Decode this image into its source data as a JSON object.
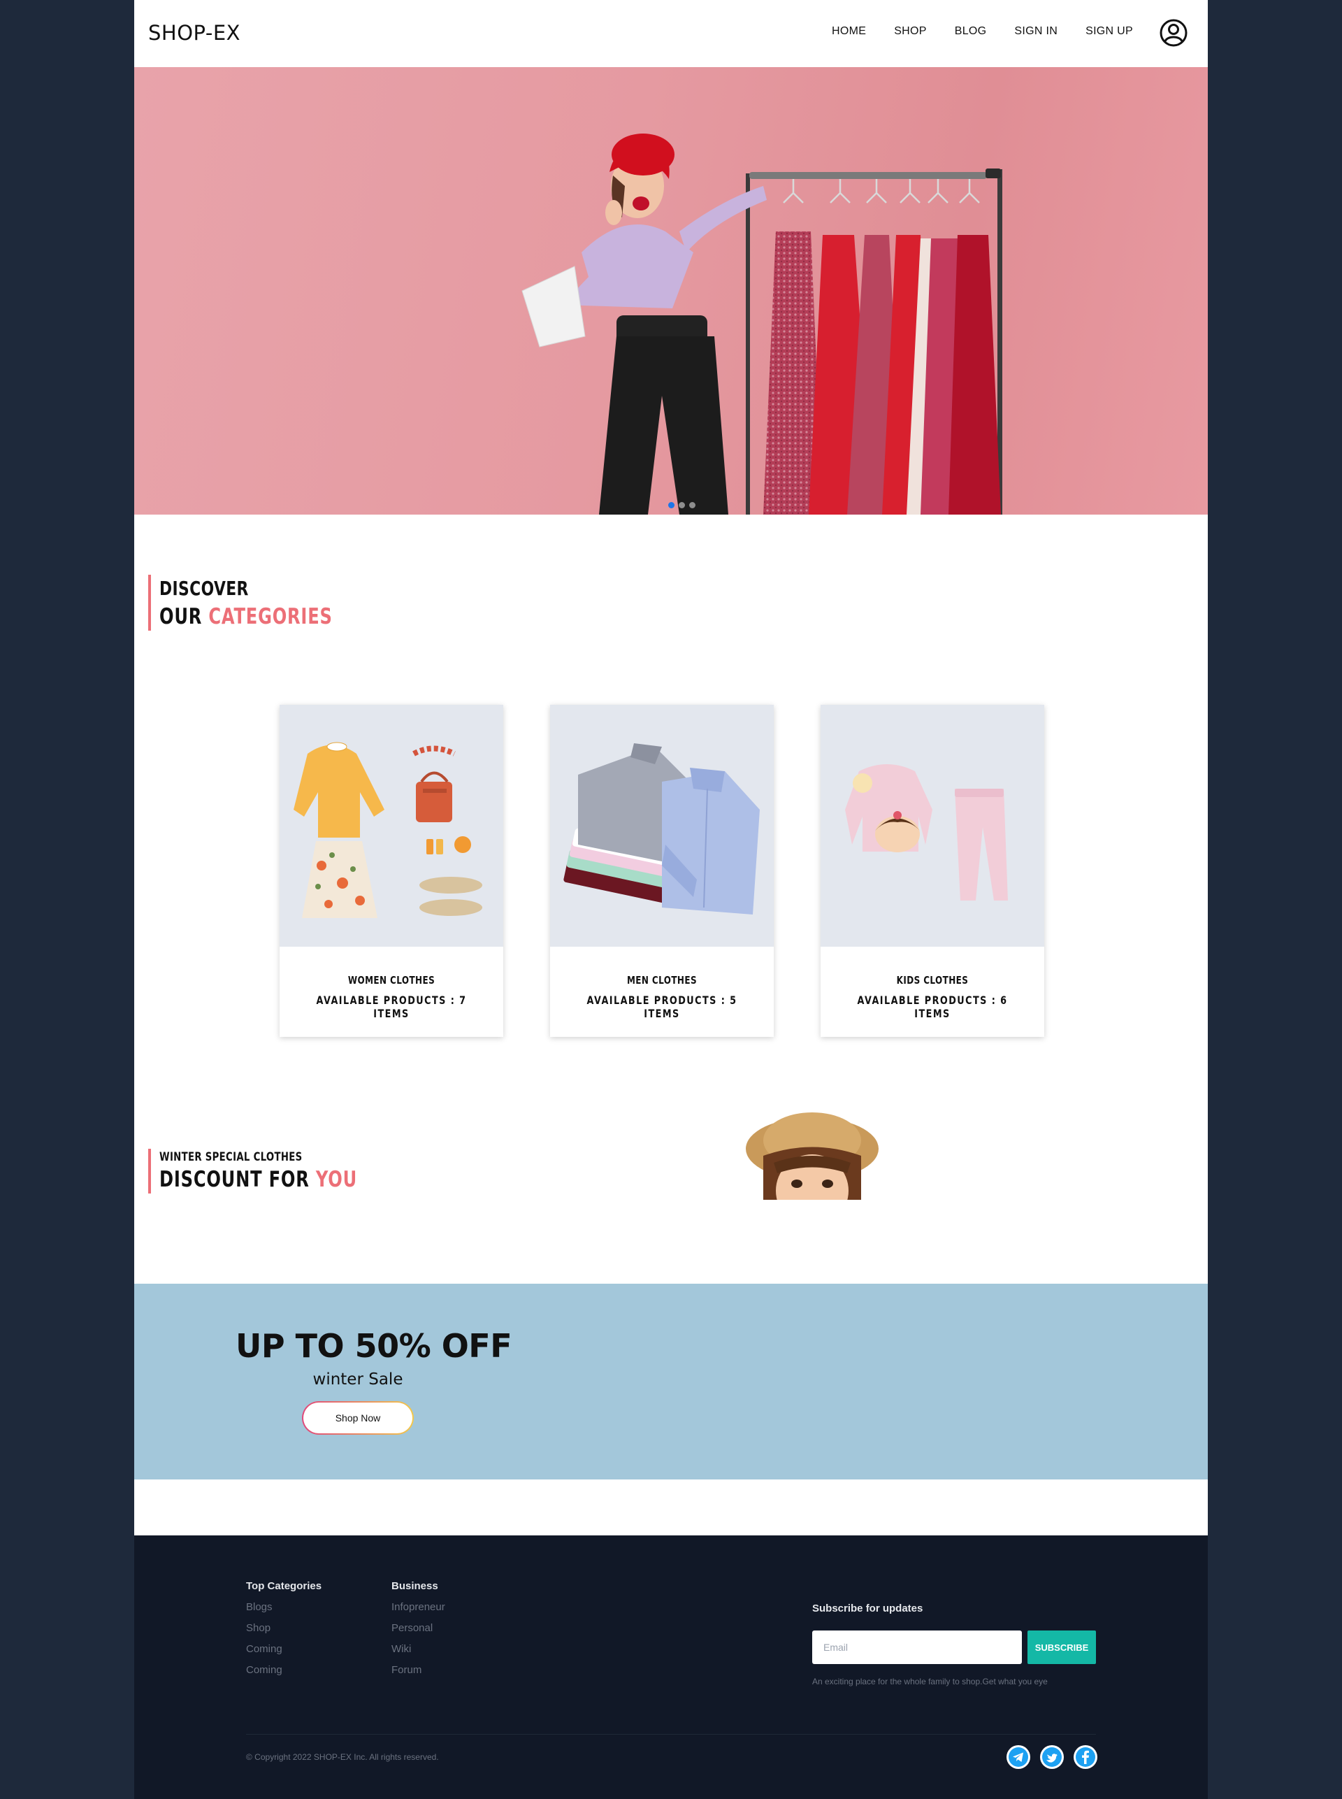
{
  "nav": {
    "logo": "SHOP-EX",
    "links": [
      "HOME",
      "SHOP",
      "BLOG",
      "SIGN IN",
      "SIGN UP"
    ],
    "user_icon": "user-circle-icon"
  },
  "hero": {
    "slides_count": 3,
    "active_slide": 1
  },
  "categories_heading": {
    "line1": "Discover",
    "line2_prefix": "Our ",
    "line2_accent": "Categories"
  },
  "categories": [
    {
      "title": "WOMEN CLOTHES",
      "count": "AVAILABLE PRODUCTS : 7 ITEMS"
    },
    {
      "title": "MEN CLOTHES",
      "count": "AVAILABLE PRODUCTS : 5 ITEMS"
    },
    {
      "title": "KIDS CLOTHES",
      "count": "AVAILABLE PRODUCTS : 6 ITEMS"
    }
  ],
  "discount_heading": {
    "small": "Winter Special Clothes",
    "prefix": "Discount For ",
    "accent": "You"
  },
  "promo": {
    "title": "UP TO 50% OFF",
    "subtitle": "winter Sale",
    "button": "Shop Now"
  },
  "footer": {
    "col1": {
      "title": "Top Categories",
      "items": [
        "Blogs",
        "Shop",
        "Coming",
        "Coming"
      ]
    },
    "col2": {
      "title": "Business",
      "items": [
        "Infopreneur",
        "Personal",
        "Wiki",
        "Forum"
      ]
    },
    "subscribe": {
      "title": "Subscribe for updates",
      "placeholder": "Email",
      "button": "SUBSCRIBE",
      "note": "An exciting place for the whole family to shop.Get what you eye"
    },
    "copyright": "© Copyright 2022 SHOP-EX Inc. All rights reserved.",
    "social": [
      "telegram-icon",
      "twitter-icon",
      "facebook-icon"
    ]
  },
  "colors": {
    "accent": "#ec6f77",
    "promo_bg": "#a3c7da",
    "footer_bg": "#111827",
    "subscribe_btn": "#14b8a6",
    "outer_bg": "#1e293b",
    "social_icon": "#1da1f2"
  }
}
